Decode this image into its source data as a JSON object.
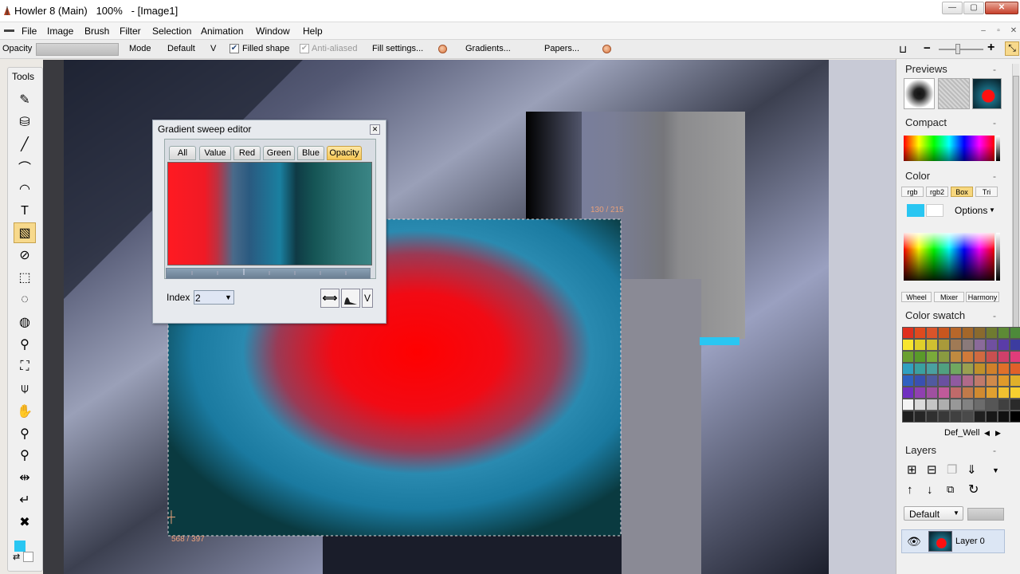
{
  "window": {
    "title": "Howler 8 (Main)   100%   - [Image1]",
    "controls": {
      "minimize": "—",
      "maximize": "▢",
      "close": "✕"
    }
  },
  "menubar": {
    "items": [
      "File",
      "Image",
      "Brush",
      "Filter",
      "Selection",
      "Animation",
      "Window",
      "Help"
    ],
    "mdi": {
      "minimize": "–",
      "restore": "▫",
      "close": "✕"
    }
  },
  "options_bar": {
    "opacity_label": "Opacity",
    "mode_label": "Mode",
    "mode_value": "Default",
    "v_label": "V",
    "filled_shape": {
      "label": "Filled shape",
      "checked": true
    },
    "anti_aliased": {
      "label": "Anti-aliased",
      "checked": true,
      "disabled": true
    },
    "fill_settings": "Fill settings...",
    "gradients": "Gradients...",
    "papers": "Papers...",
    "zoom_minus": "−",
    "zoom_plus": "+"
  },
  "tools": {
    "title": "Tools",
    "items": [
      {
        "name": "pencil-tool-icon",
        "glyph": "✎"
      },
      {
        "name": "paint-bucket-tool-icon",
        "glyph": "⛁"
      },
      {
        "name": "line-tool-icon",
        "glyph": "╱"
      },
      {
        "name": "curve-tool-icon",
        "glyph": "⌒"
      },
      {
        "name": "arc-tool-icon",
        "glyph": "◠"
      },
      {
        "name": "text-tool-icon",
        "glyph": "T"
      },
      {
        "name": "gradient-rect-tool-icon",
        "glyph": "▧",
        "selected": true
      },
      {
        "name": "gradient-ellipse-tool-icon",
        "glyph": "⊘"
      },
      {
        "name": "rect-select-tool-icon",
        "glyph": "⬚"
      },
      {
        "name": "ellipse-select-tool-icon",
        "glyph": "◌"
      },
      {
        "name": "lasso-tool-icon",
        "glyph": "◍"
      },
      {
        "name": "magic-wand-tool-icon",
        "glyph": "⚲"
      },
      {
        "name": "crop-tool-icon",
        "glyph": "⛶"
      },
      {
        "name": "eyedropper-tool-icon",
        "glyph": "⍦"
      },
      {
        "name": "hand-tool-icon",
        "glyph": "✋"
      },
      {
        "name": "zoom-tool-icon",
        "glyph": "⚲"
      },
      {
        "name": "zoom-100-tool-icon",
        "glyph": "⚲"
      },
      {
        "name": "transform-tool-icon",
        "glyph": "⇹"
      },
      {
        "name": "apply-tool-icon",
        "glyph": "↵"
      },
      {
        "name": "cancel-tool-icon",
        "glyph": "✖"
      }
    ],
    "colors": {
      "fg": "#29c6f2",
      "bg": "#ffffff"
    }
  },
  "canvas": {
    "coord_top": "130 / 215",
    "coord_bottom": "568 / 397"
  },
  "gradient_editor": {
    "title": "Gradient sweep editor",
    "close": "✕",
    "tabs": [
      {
        "label": "All",
        "active": false
      },
      {
        "label": "Value",
        "active": false
      },
      {
        "label": "Red",
        "active": false
      },
      {
        "label": "Green",
        "active": false
      },
      {
        "label": "Blue",
        "active": false
      },
      {
        "label": "Opacity",
        "active": true
      }
    ],
    "index_label": "Index",
    "index_value": "2",
    "btn_v": "V"
  },
  "right_panel": {
    "previews_title": "Previews",
    "compact_title": "Compact",
    "color_title": "Color",
    "color_tabs": [
      {
        "label": "rgb",
        "active": false
      },
      {
        "label": "rgb2",
        "active": false
      },
      {
        "label": "Box",
        "active": true
      },
      {
        "label": "Tri",
        "active": false
      }
    ],
    "options_label": "Options",
    "fg_color": "#29c6f2",
    "bg_color": "#ffffff",
    "mixer_tabs": [
      "Wheel",
      "Mixer",
      "Harmony"
    ],
    "swatch_title": "Color swatch",
    "swatch_name": "Def_Well",
    "swatches": [
      "#e0301e",
      "#e04a1e",
      "#d9542a",
      "#c9561f",
      "#b8672a",
      "#a4672a",
      "#8a6a2e",
      "#6f7b30",
      "#5d8a35",
      "#4d8a3a",
      "#f7e530",
      "#e0cf2a",
      "#d0c030",
      "#a99a3a",
      "#a07a55",
      "#8a7a7a",
      "#8a6a9a",
      "#7050a0",
      "#5a3ca8",
      "#3c3ca0",
      "#6aa030",
      "#5a9a2a",
      "#7aaa3a",
      "#8a9a40",
      "#c08a40",
      "#d07a3a",
      "#d06a40",
      "#c85050",
      "#d0406a",
      "#e03c7a",
      "#30a0c0",
      "#3aa0a0",
      "#4aa0a0",
      "#50a080",
      "#70a860",
      "#9aa050",
      "#c0902a",
      "#d0802a",
      "#e0702a",
      "#e0602a",
      "#3060c0",
      "#3a50b0",
      "#505aa0",
      "#6a50a0",
      "#905aa0",
      "#b06a8a",
      "#c07a6a",
      "#d08a4a",
      "#e09a2a",
      "#e0b02a",
      "#7030c0",
      "#9040b0",
      "#a050a0",
      "#c05a9a",
      "#c06a6a",
      "#c07a4a",
      "#d08a30",
      "#e0a030",
      "#f0c030",
      "#f7d030",
      "#f4f4f4",
      "#dadada",
      "#c4c4c4",
      "#aeaeae",
      "#989898",
      "#828282",
      "#6c6c6c",
      "#565656",
      "#404040",
      "#2a2a2a",
      "#1e1e1e",
      "#262626",
      "#303030",
      "#383838",
      "#404040",
      "#4a4a4a",
      "#202020",
      "#181818",
      "#101010",
      "#000000"
    ],
    "layers_title": "Layers",
    "blend_mode": "Default",
    "layer_name": "Layer 0"
  }
}
